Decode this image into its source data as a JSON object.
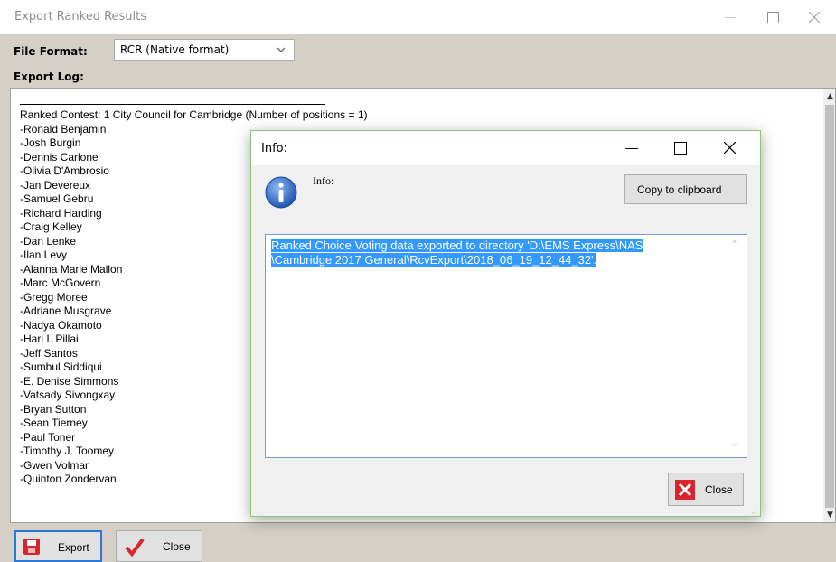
{
  "window": {
    "title": "Export Ranked Results",
    "controls": [
      "minimize-icon",
      "maximize-icon",
      "close-icon"
    ]
  },
  "file_format": {
    "label": "File Format:",
    "selected": "RCR (Native format)"
  },
  "export_log": {
    "label": "Export Log:",
    "lines": [
      "Ranked Contest: 1 City Council for Cambridge (Number of positions = 1)",
      "-Ronald Benjamin",
      "-Josh Burgin",
      "-Dennis Carlone",
      "-Olivia D'Ambrosio",
      "-Jan Devereux",
      "-Samuel Gebru",
      "-Richard Harding",
      "-Craig Kelley",
      "-Dan Lenke",
      "-Ilan Levy",
      "-Alanna Marie Mallon",
      "-Marc McGovern",
      "-Gregg Moree",
      "-Adriane Musgrave",
      "-Nadya Okamoto",
      "-Hari I. Pillai",
      "-Jeff Santos",
      "-Sumbul Siddiqui",
      "-E. Denise Simmons",
      "-Vatsady Sivongxay",
      "-Bryan Sutton",
      "-Sean Tierney",
      "-Paul Toner",
      "-Timothy J. Toomey",
      "-Gwen Volmar",
      "-Quinton Zondervan"
    ]
  },
  "buttons": {
    "export_label": "Export",
    "close_label": "Close"
  },
  "dialog": {
    "title": "Info:",
    "info_label": "Info:",
    "copy_label": "Copy to clipboard",
    "message": "Ranked Choice Voting data exported to directory 'D:\\EMS Express\\NAS \\Cambridge 2017 General\\RcvExport\\2018_06_19_12_44_32'.",
    "close_label": "Close",
    "colors": {
      "selection": "#3399ff",
      "close_icon": "#d9262d",
      "info_icon": "#2c6cc9"
    }
  },
  "colors": {
    "window_bg": "#d4d0c8",
    "export_icon": "#d9262d",
    "check_icon": "#d9262d",
    "focus_border": "#2b79d7"
  }
}
